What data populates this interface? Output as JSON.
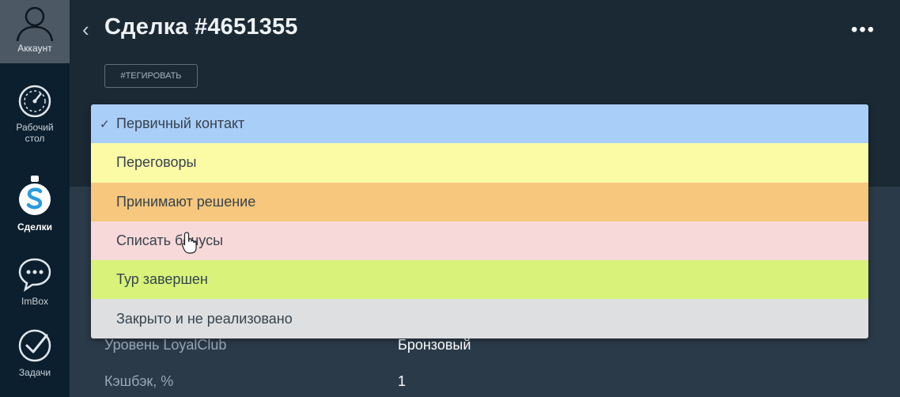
{
  "sidebar": {
    "account_label": "Аккаунт",
    "items": [
      {
        "label": "Рабочий стол",
        "icon": "dashboard-icon"
      },
      {
        "label": "Сделки",
        "icon": "deals-icon",
        "active": true
      },
      {
        "label": "ImBox",
        "icon": "chat-icon"
      },
      {
        "label": "Задачи",
        "icon": "tasks-icon"
      }
    ]
  },
  "header": {
    "title": "Сделка #4651355",
    "tag_button": "#ТЕГИРОВАТЬ",
    "more": "•••"
  },
  "dropdown": {
    "options": [
      {
        "label": "Первичный контакт",
        "color": "#a9cef7",
        "selected": true
      },
      {
        "label": "Переговоры",
        "color": "#fbfba6"
      },
      {
        "label": "Принимают решение",
        "color": "#f6c77c"
      },
      {
        "label": "Списать бонусы",
        "color": "#f8d9d9"
      },
      {
        "label": "Тур завершен",
        "color": "#d8f27a"
      },
      {
        "label": "Закрыто и не реализовано",
        "color": "#dddfe1"
      }
    ]
  },
  "info": [
    {
      "label": "Уровень LoyalClub",
      "value": "Бронзовый"
    },
    {
      "label": "Кэшбэк, %",
      "value": "1"
    }
  ],
  "colors": {
    "sidebar": "#0c1f2e",
    "header": "#1b2935",
    "content": "#2a3a48"
  }
}
